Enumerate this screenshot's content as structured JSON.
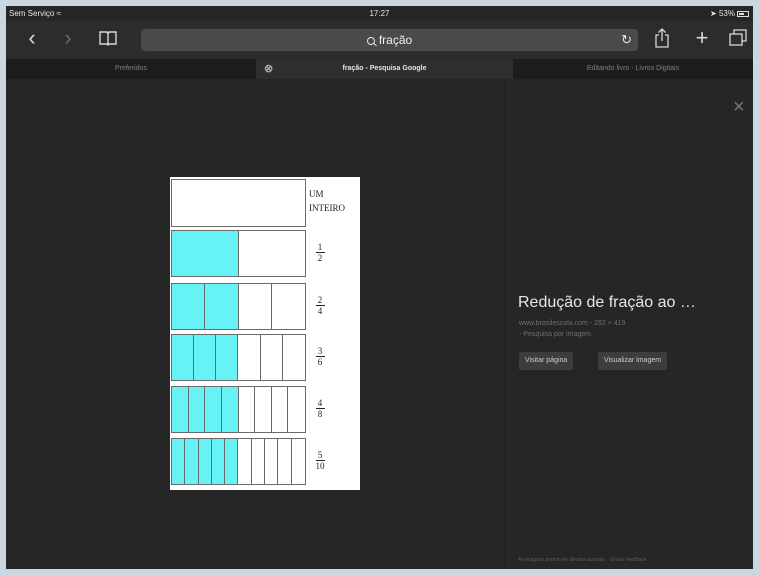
{
  "status_bar": {
    "carrier": "Sem Serviço",
    "time": "17:27",
    "battery": "53%"
  },
  "toolbar": {
    "address_text": "fração",
    "icons": [
      "back-icon",
      "forward-icon",
      "bookmarks-icon",
      "reload-icon",
      "share-icon",
      "new-tab-icon",
      "tabs-icon"
    ]
  },
  "tabs": [
    {
      "label": "Preferidos",
      "active": false
    },
    {
      "label": "fração - Pesquisa Google",
      "active": true
    },
    {
      "label": "Editando livro - Livros Digitais",
      "active": false
    }
  ],
  "image_preview": {
    "unit_label_line1": "UM",
    "unit_label_line2": "INTEIRO",
    "fill_color": "#67f3f6",
    "rows": [
      {
        "numerator": "1",
        "denominator": "2",
        "parts": 2,
        "filled": 1
      },
      {
        "numerator": "2",
        "denominator": "4",
        "parts": 4,
        "filled": 2
      },
      {
        "numerator": "3",
        "denominator": "6",
        "parts": 6,
        "filled": 3
      },
      {
        "numerator": "4",
        "denominator": "8",
        "parts": 8,
        "filled": 4
      },
      {
        "numerator": "5",
        "denominator": "10",
        "parts": 10,
        "filled": 5
      }
    ]
  },
  "info_panel": {
    "title": "Redução de fração ao …",
    "source": "www.brasilescola.com - 252 × 419",
    "search_link": "- Pesquisa por imagem",
    "visit_button": "Visitar página",
    "view_button": "Visualizar imagem",
    "footnote": "As imagens podem ter direitos autorais. - Enviar feedback"
  }
}
